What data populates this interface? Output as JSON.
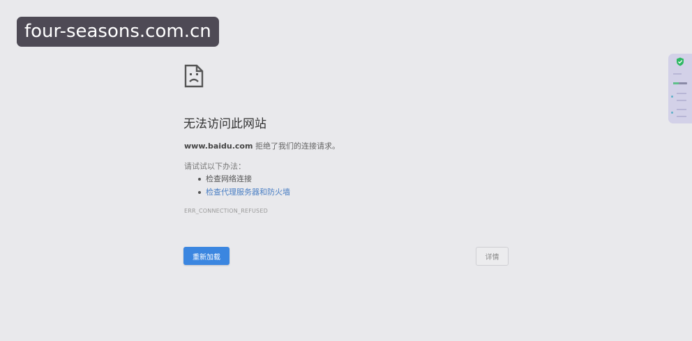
{
  "watermark": {
    "text": "four-seasons.com.cn"
  },
  "error_page": {
    "title": "无法访问此网站",
    "host": "www.baidu.com",
    "refused_text": " 拒绝了我们的连接请求。",
    "try_label": "请试试以下办法：",
    "suggestions": [
      {
        "label": "检查网络连接",
        "is_link": false
      },
      {
        "label": "检查代理服务器和防火墙",
        "is_link": true
      }
    ],
    "error_code": "ERR_CONNECTION_REFUSED",
    "reload_label": "重新加载",
    "details_label": "详情"
  },
  "icons": {
    "sad_page": "sad-page-icon",
    "shield": "shield-check-icon"
  },
  "colors": {
    "background": "#e9e9ec",
    "primary_button": "#3b86e0",
    "link": "#4a7fc4",
    "watermark_bg": "#4e4a55",
    "widget_bg": "#d3d1e8"
  }
}
